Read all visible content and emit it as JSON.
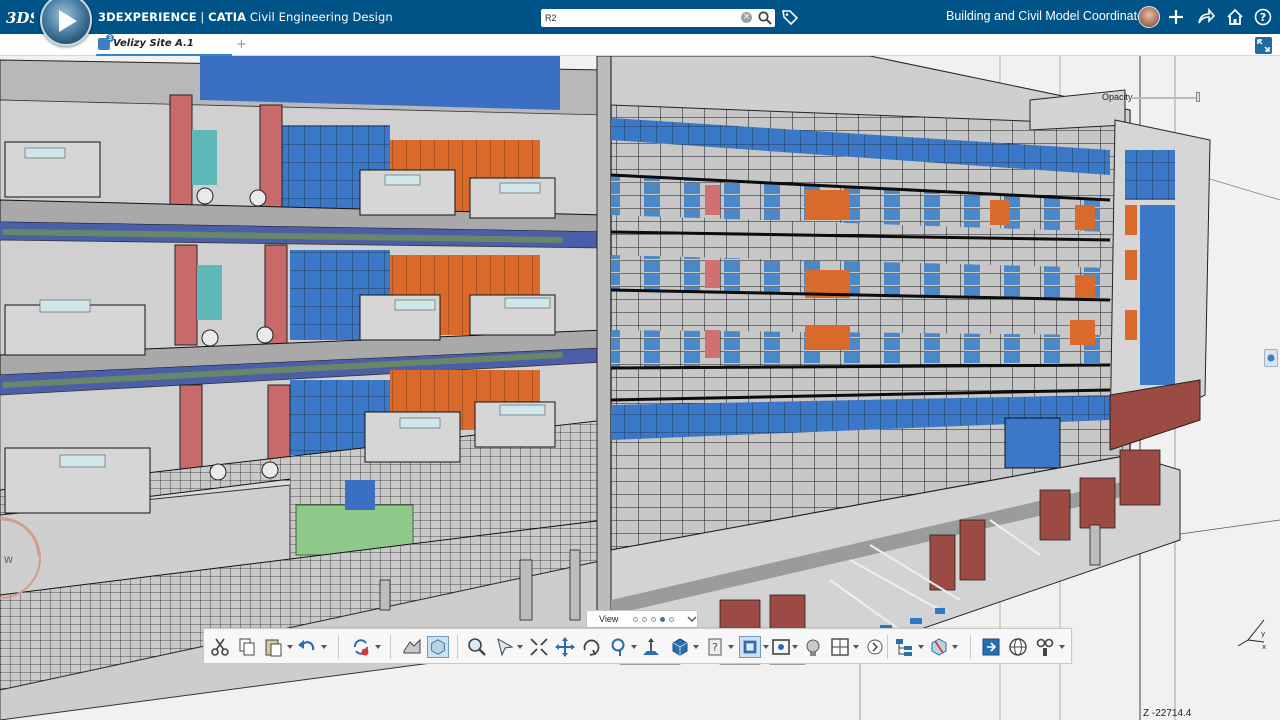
{
  "topbar": {
    "brand": "3DEXPERIENCE",
    "separator": " | ",
    "product": "CATIA",
    "app_name": "Civil Engineering Design",
    "role": "Building and Civil Model Coordinator",
    "logo_text": "3DS"
  },
  "search": {
    "value": "R2",
    "placeholder": "Search"
  },
  "tabs": [
    {
      "label": "Velizy Site A.1",
      "active": true
    }
  ],
  "tab_add": "+",
  "viewport": {
    "opacity_label": "Opacity",
    "opacity_value": 1.0,
    "z_readout": "Z -22714.4",
    "compass_letter": "W"
  },
  "section_toolbar": {
    "ok_label": "✓"
  },
  "view_drawer": {
    "label": "View",
    "pages": 5,
    "active_page": 4
  },
  "icons": {
    "topbar": [
      "tag-icon",
      "add-icon",
      "share-icon",
      "home-icon",
      "help-icon"
    ],
    "action_bar": [
      "cut-icon",
      "copy-icon",
      "paste-icon",
      "undo-icon",
      "update-icon",
      "part-icon",
      "box-icon",
      "zoom-area-icon",
      "fly-icon",
      "fit-all-icon",
      "pan-icon",
      "rotate-icon",
      "zoom-icon",
      "normal-view-icon",
      "cube-view-icon",
      "help-icon",
      "view-mode-icon",
      "capture-icon",
      "ambiance-icon",
      "layout-icon",
      "more-icon",
      "tree-icon",
      "section-icon",
      "export-icon",
      "globe-icon",
      "tools-icon"
    ]
  },
  "colors": {
    "topbar": "#005386",
    "accent": "#2d89c8",
    "facade_orange": "#d96a2c",
    "glass_blue": "#3b78c7",
    "column_red": "#c96a6a",
    "terracotta": "#9c4a44",
    "ok_green": "#3fa33b"
  }
}
